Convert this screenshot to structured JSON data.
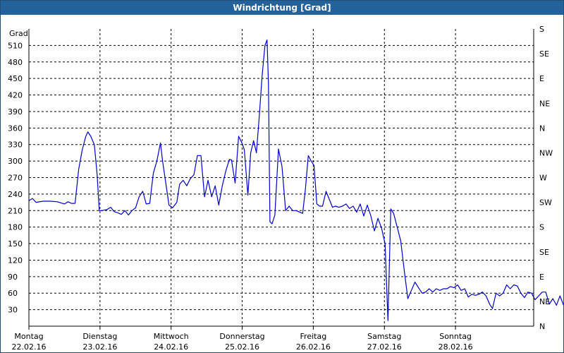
{
  "window": {
    "title": "Windrichtung [Grad]"
  },
  "chart_data": {
    "type": "line",
    "title": "Windrichtung [Grad]",
    "ylabel": "Grad",
    "xlabel": "",
    "ylim": [
      0,
      540
    ],
    "xlim": [
      0,
      7
    ],
    "grid": true,
    "legend": "none",
    "line_color": "#0000cc",
    "grid_color": "#000000",
    "y_ticks": [
      30,
      60,
      90,
      120,
      150,
      180,
      210,
      240,
      270,
      300,
      330,
      360,
      390,
      420,
      450,
      480,
      510
    ],
    "right_axis": {
      "ticks": [
        {
          "value": 0,
          "label": "N"
        },
        {
          "value": 45,
          "label": "NE"
        },
        {
          "value": 90,
          "label": "E"
        },
        {
          "value": 135,
          "label": "SE"
        },
        {
          "value": 180,
          "label": "S"
        },
        {
          "value": 225,
          "label": "SW"
        },
        {
          "value": 270,
          "label": "W"
        },
        {
          "value": 315,
          "label": "NW"
        },
        {
          "value": 360,
          "label": "N"
        },
        {
          "value": 405,
          "label": "NE"
        },
        {
          "value": 450,
          "label": "E"
        },
        {
          "value": 495,
          "label": "SE"
        },
        {
          "value": 540,
          "label": "S"
        }
      ]
    },
    "x_ticks": [
      {
        "value": 0,
        "day": "Montag",
        "date": "22.02.16"
      },
      {
        "value": 1,
        "day": "Dienstag",
        "date": "23.02.16"
      },
      {
        "value": 2,
        "day": "Mittwoch",
        "date": "24.02.16"
      },
      {
        "value": 3,
        "day": "Donnerstag",
        "date": "25.02.16"
      },
      {
        "value": 4,
        "day": "Freitag",
        "date": "26.02.16"
      },
      {
        "value": 5,
        "day": "Samstag",
        "date": "27.02.16"
      },
      {
        "value": 6,
        "day": "Sonntag",
        "date": "28.02.16"
      }
    ],
    "series": [
      {
        "points": [
          [
            0.0,
            228
          ],
          [
            0.05,
            232
          ],
          [
            0.1,
            225
          ],
          [
            0.2,
            227
          ],
          [
            0.3,
            227
          ],
          [
            0.4,
            226
          ],
          [
            0.5,
            222
          ],
          [
            0.55,
            226
          ],
          [
            0.6,
            223
          ],
          [
            0.65,
            223
          ],
          [
            0.7,
            285
          ],
          [
            0.75,
            320
          ],
          [
            0.8,
            345
          ],
          [
            0.83,
            353
          ],
          [
            0.87,
            345
          ],
          [
            0.92,
            330
          ],
          [
            0.96,
            275
          ],
          [
            0.99,
            210
          ],
          [
            1.03,
            210
          ],
          [
            1.1,
            212
          ],
          [
            1.15,
            216
          ],
          [
            1.2,
            208
          ],
          [
            1.25,
            206
          ],
          [
            1.3,
            203
          ],
          [
            1.35,
            210
          ],
          [
            1.4,
            202
          ],
          [
            1.45,
            210
          ],
          [
            1.5,
            215
          ],
          [
            1.55,
            235
          ],
          [
            1.6,
            245
          ],
          [
            1.65,
            222
          ],
          [
            1.7,
            223
          ],
          [
            1.75,
            278
          ],
          [
            1.8,
            300
          ],
          [
            1.85,
            333
          ],
          [
            1.88,
            300
          ],
          [
            1.92,
            265
          ],
          [
            1.97,
            220
          ],
          [
            2.02,
            215
          ],
          [
            2.08,
            225
          ],
          [
            2.12,
            258
          ],
          [
            2.17,
            265
          ],
          [
            2.22,
            255
          ],
          [
            2.27,
            268
          ],
          [
            2.32,
            275
          ],
          [
            2.37,
            310
          ],
          [
            2.42,
            310
          ],
          [
            2.47,
            235
          ],
          [
            2.52,
            265
          ],
          [
            2.57,
            235
          ],
          [
            2.62,
            255
          ],
          [
            2.67,
            220
          ],
          [
            2.72,
            255
          ],
          [
            2.77,
            282
          ],
          [
            2.82,
            303
          ],
          [
            2.85,
            302
          ],
          [
            2.9,
            260
          ],
          [
            2.95,
            345
          ],
          [
            3.0,
            332
          ],
          [
            3.03,
            320
          ],
          [
            3.08,
            238
          ],
          [
            3.12,
            315
          ],
          [
            3.16,
            337
          ],
          [
            3.2,
            315
          ],
          [
            3.24,
            380
          ],
          [
            3.28,
            455
          ],
          [
            3.32,
            510
          ],
          [
            3.35,
            520
          ],
          [
            3.37,
            440
          ],
          [
            3.39,
            190
          ],
          [
            3.42,
            186
          ],
          [
            3.46,
            202
          ],
          [
            3.51,
            322
          ],
          [
            3.56,
            290
          ],
          [
            3.61,
            210
          ],
          [
            3.66,
            218
          ],
          [
            3.71,
            210
          ],
          [
            3.76,
            210
          ],
          [
            3.81,
            207
          ],
          [
            3.85,
            205
          ],
          [
            3.89,
            250
          ],
          [
            3.93,
            310
          ],
          [
            3.97,
            300
          ],
          [
            4.01,
            292
          ],
          [
            4.05,
            222
          ],
          [
            4.09,
            218
          ],
          [
            4.13,
            218
          ],
          [
            4.18,
            245
          ],
          [
            4.22,
            232
          ],
          [
            4.27,
            216
          ],
          [
            4.31,
            218
          ],
          [
            4.36,
            216
          ],
          [
            4.41,
            218
          ],
          [
            4.46,
            222
          ],
          [
            4.51,
            214
          ],
          [
            4.56,
            218
          ],
          [
            4.61,
            207
          ],
          [
            4.66,
            222
          ],
          [
            4.71,
            200
          ],
          [
            4.76,
            220
          ],
          [
            4.81,
            200
          ],
          [
            4.86,
            173
          ],
          [
            4.91,
            196
          ],
          [
            4.96,
            178
          ],
          [
            5.01,
            150
          ],
          [
            5.05,
            10
          ],
          [
            5.09,
            213
          ],
          [
            5.13,
            205
          ],
          [
            5.18,
            180
          ],
          [
            5.23,
            155
          ],
          [
            5.28,
            100
          ],
          [
            5.33,
            50
          ],
          [
            5.38,
            65
          ],
          [
            5.43,
            80
          ],
          [
            5.48,
            70
          ],
          [
            5.53,
            60
          ],
          [
            5.58,
            62
          ],
          [
            5.63,
            68
          ],
          [
            5.68,
            62
          ],
          [
            5.73,
            68
          ],
          [
            5.78,
            65
          ],
          [
            5.83,
            68
          ],
          [
            5.88,
            68
          ],
          [
            5.93,
            72
          ],
          [
            5.98,
            70
          ],
          [
            6.03,
            75
          ],
          [
            6.08,
            65
          ],
          [
            6.13,
            68
          ],
          [
            6.18,
            53
          ],
          [
            6.23,
            58
          ],
          [
            6.28,
            56
          ],
          [
            6.33,
            58
          ],
          [
            6.38,
            62
          ],
          [
            6.43,
            55
          ],
          [
            6.48,
            40
          ],
          [
            6.52,
            32
          ],
          [
            6.57,
            60
          ],
          [
            6.62,
            55
          ],
          [
            6.67,
            60
          ],
          [
            6.72,
            75
          ],
          [
            6.77,
            68
          ],
          [
            6.82,
            75
          ],
          [
            6.87,
            73
          ],
          [
            6.92,
            60
          ],
          [
            6.97,
            52
          ],
          [
            7.02,
            62
          ],
          [
            7.07,
            60
          ],
          [
            7.12,
            48
          ],
          [
            7.17,
            55
          ],
          [
            7.22,
            62
          ],
          [
            7.27,
            62
          ],
          [
            7.32,
            40
          ],
          [
            7.37,
            50
          ],
          [
            7.42,
            38
          ],
          [
            7.47,
            55
          ],
          [
            7.52,
            38
          ],
          [
            7.57,
            50
          ],
          [
            7.62,
            35
          ],
          [
            7.67,
            48
          ],
          [
            7.72,
            40
          ],
          [
            7.77,
            35
          ],
          [
            7.82,
            40
          ],
          [
            7.87,
            45
          ],
          [
            7.93,
            38
          ]
        ]
      }
    ]
  }
}
